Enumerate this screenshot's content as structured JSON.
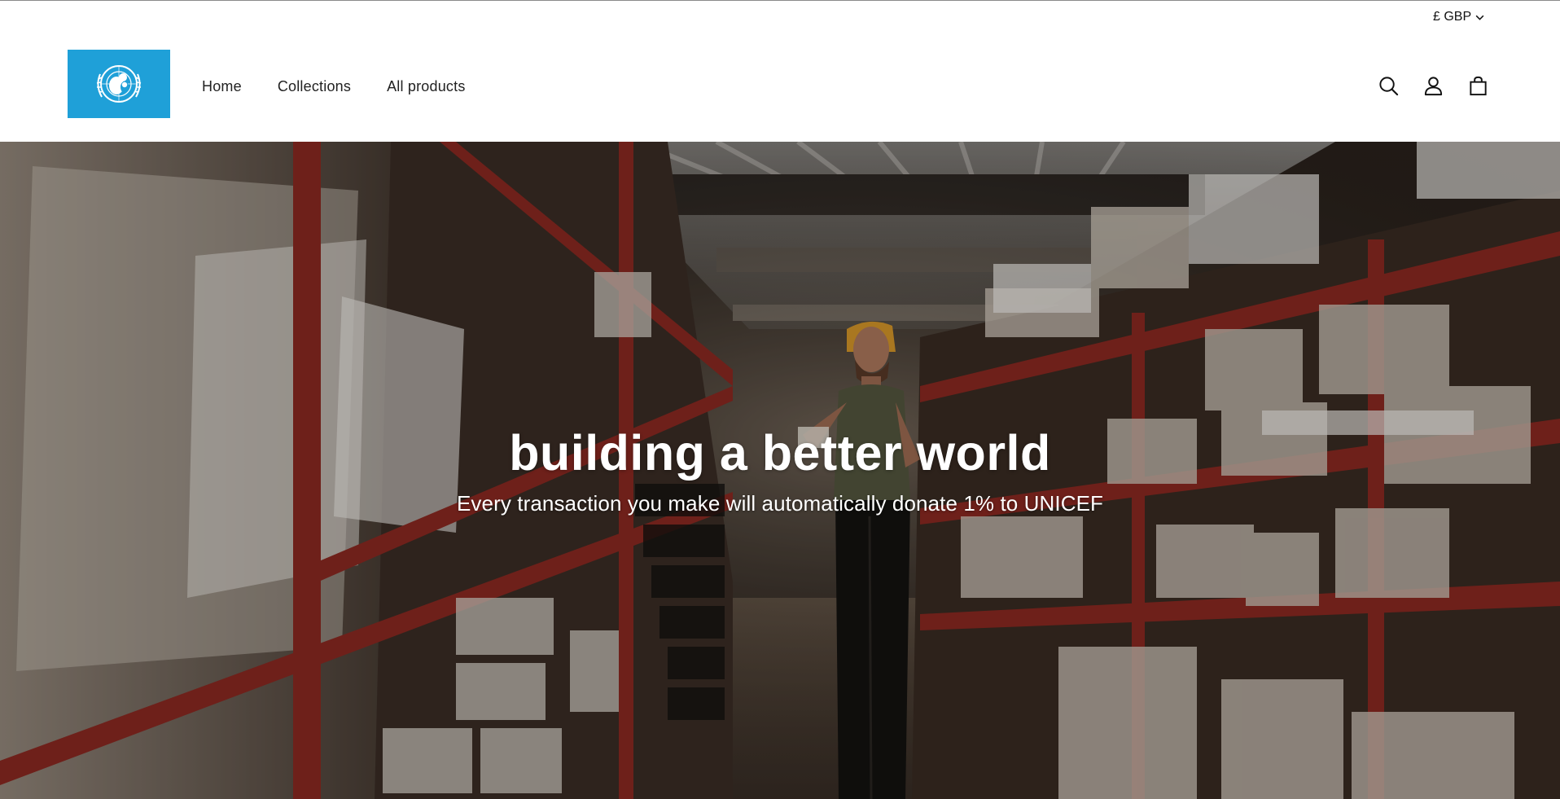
{
  "header": {
    "currency_label": "£ GBP",
    "logo_alt": "UNICEF",
    "nav": [
      {
        "label": "Home"
      },
      {
        "label": "Collections"
      },
      {
        "label": "All products"
      }
    ],
    "icons": [
      "search-icon",
      "account-icon",
      "cart-icon"
    ]
  },
  "hero": {
    "title": "building a better world",
    "subtitle": "Every transaction you make will automatically donate 1% to UNICEF"
  },
  "colors": {
    "logo_background": "#1fa0d8",
    "text": "#121212",
    "hero_text": "#ffffff"
  }
}
